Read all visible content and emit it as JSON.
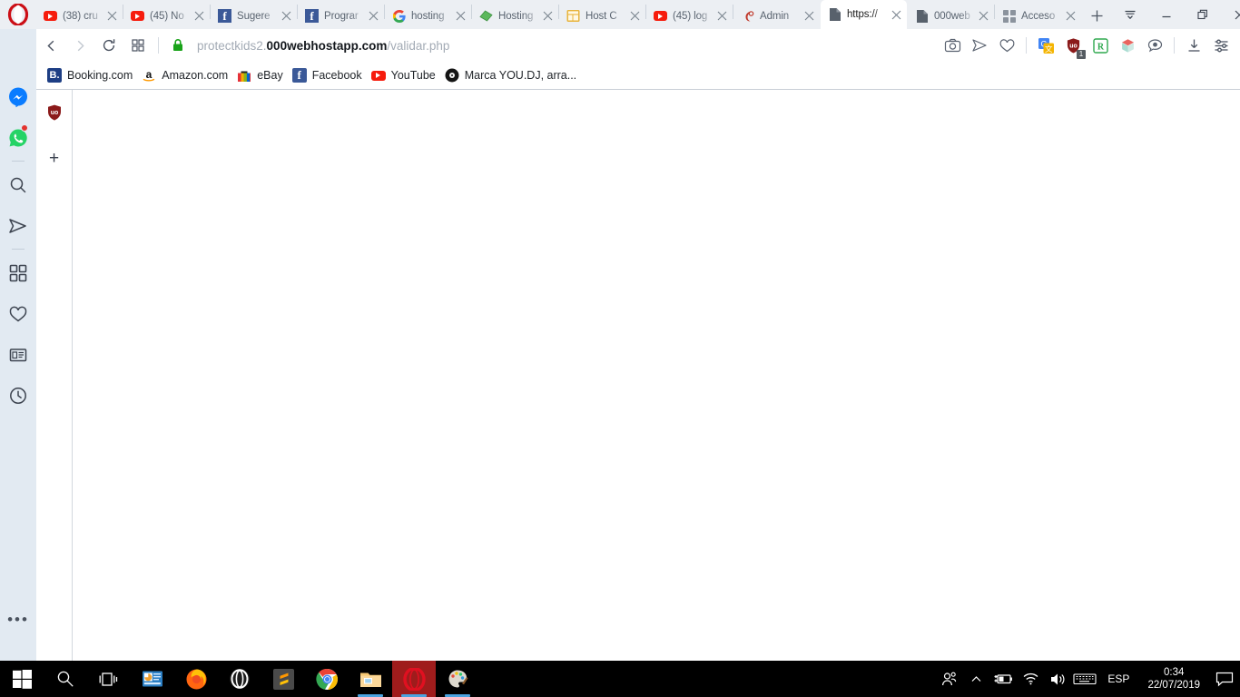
{
  "browser": {
    "name": "Opera",
    "logo_icon": "opera-logo"
  },
  "tabs": [
    {
      "title": "(38) cru",
      "favicon": "youtube-icon",
      "active": false
    },
    {
      "title": "(45) No",
      "favicon": "youtube-icon",
      "active": false
    },
    {
      "title": "Sugere",
      "favicon": "facebook-icon",
      "active": false
    },
    {
      "title": "Prograr",
      "favicon": "facebook-icon",
      "active": false
    },
    {
      "title": "hosting",
      "favicon": "google-icon",
      "active": false
    },
    {
      "title": "Hosting",
      "favicon": "green-diamond-icon",
      "active": false
    },
    {
      "title": "Host C",
      "favicon": "cpanel-icon",
      "active": false
    },
    {
      "title": "(45) log",
      "favicon": "youtube-icon",
      "active": false
    },
    {
      "title": "Admin",
      "favicon": "phpmyadmin-icon",
      "active": false
    },
    {
      "title": "https://",
      "favicon": "blank-page-icon",
      "active": true
    },
    {
      "title": "000web",
      "favicon": "blank-page-icon",
      "active": false
    },
    {
      "title": "Acceso",
      "favicon": "grid-icon",
      "active": false
    }
  ],
  "tab_controls": {
    "new_tab": "+",
    "tab_menu_icon": "tab-list-icon",
    "minimize_icon": "minimize-icon",
    "restore_icon": "restore-icon",
    "close_icon": "close-icon"
  },
  "navbar": {
    "back_icon": "back-arrow-icon",
    "forward_icon": "forward-arrow-icon",
    "reload_icon": "reload-icon",
    "speeddial_icon": "speed-dial-icon",
    "lock_icon": "padlock-icon",
    "lock_color": "#19a319",
    "url_prefix": "protectkids2.",
    "url_domain": "000webhostapp.com",
    "url_path": "/validar.php",
    "url_full": "protectkids2.000webhostapp.com/validar.php",
    "right_icons": [
      {
        "name": "snapshot-icon",
        "label": "Snapshot"
      },
      {
        "name": "send-to-device-icon",
        "label": "Send to my devices"
      },
      {
        "name": "heart-icon",
        "label": "Add to bookmarks"
      }
    ],
    "extensions": [
      {
        "name": "google-translate-extension",
        "badge": ""
      },
      {
        "name": "ublock-origin-extension",
        "badge": "1"
      },
      {
        "name": "requestly-extension",
        "badge": ""
      },
      {
        "name": "3d-box-extension",
        "badge": ""
      },
      {
        "name": "speech-bubble-extension",
        "badge": ""
      }
    ],
    "downloads_icon": "download-icon",
    "easy_setup_icon": "easy-setup-icon"
  },
  "bookmarks": [
    {
      "label": "Booking.com",
      "icon": "booking-icon"
    },
    {
      "label": "Amazon.com",
      "icon": "amazon-icon"
    },
    {
      "label": "eBay",
      "icon": "ebay-icon"
    },
    {
      "label": "Facebook",
      "icon": "facebook-icon"
    },
    {
      "label": "YouTube",
      "icon": "youtube-icon"
    },
    {
      "label": "Marca YOU.DJ, arra...",
      "icon": "vinyl-icon"
    }
  ],
  "sidebar": {
    "items": [
      {
        "name": "messenger",
        "icon": "messenger-icon",
        "badge": false
      },
      {
        "name": "whatsapp",
        "icon": "whatsapp-icon",
        "badge": true
      },
      {
        "name": "search",
        "icon": "search-icon",
        "badge": false
      },
      {
        "name": "telegram",
        "icon": "telegram-icon",
        "badge": false
      },
      {
        "name": "speed-dial",
        "icon": "grid-icon",
        "badge": false
      },
      {
        "name": "bookmarks",
        "icon": "heart-icon",
        "badge": false
      },
      {
        "name": "news",
        "icon": "news-icon",
        "badge": false
      },
      {
        "name": "history",
        "icon": "clock-icon",
        "badge": false
      }
    ],
    "more_label": "•••"
  },
  "page": {
    "content": "",
    "rail": {
      "ublock_icon": "ublock-shield-icon",
      "add_button": "+"
    }
  },
  "taskbar": {
    "items": [
      {
        "name": "start-button",
        "icon": "windows-icon",
        "active": false,
        "running": false
      },
      {
        "name": "search-button",
        "icon": "search-icon",
        "active": false,
        "running": false
      },
      {
        "name": "task-view-button",
        "icon": "task-view-icon",
        "active": false,
        "running": false
      },
      {
        "name": "powerpoint-app",
        "icon": "presentation-icon",
        "active": false,
        "running": false
      },
      {
        "name": "firefox-app",
        "icon": "firefox-icon",
        "active": false,
        "running": false
      },
      {
        "name": "opera-gx-app",
        "icon": "opera-gx-icon",
        "active": false,
        "running": false
      },
      {
        "name": "sublime-text-app",
        "icon": "sublime-icon",
        "active": false,
        "running": false
      },
      {
        "name": "chrome-app",
        "icon": "chrome-icon",
        "active": false,
        "running": false
      },
      {
        "name": "file-explorer-app",
        "icon": "folder-icon",
        "active": false,
        "running": true
      },
      {
        "name": "opera-app",
        "icon": "opera-icon",
        "active": true,
        "running": true
      },
      {
        "name": "paint-app",
        "icon": "paint-icon",
        "active": false,
        "running": true
      }
    ],
    "tray": {
      "people_icon": "people-icon",
      "overflow_icon": "chevron-up-icon",
      "battery_icon": "battery-charging-icon",
      "wifi_icon": "wifi-icon",
      "volume_icon": "volume-icon",
      "keyboard_icon": "keyboard-icon",
      "language": "ESP",
      "time": "0:34",
      "date": "22/07/2019",
      "notification_icon": "action-center-icon"
    }
  },
  "colors": {
    "tabstrip_bg": "#eceff3",
    "toolbar_bg": "#ffffff",
    "sidebar_bg": "#e2eaf2",
    "page_bg": "#ffffff",
    "taskbar_bg": "#000000",
    "opera_red": "#cc0f16",
    "lock_green": "#19a319",
    "badge_red": "#e3342f"
  }
}
